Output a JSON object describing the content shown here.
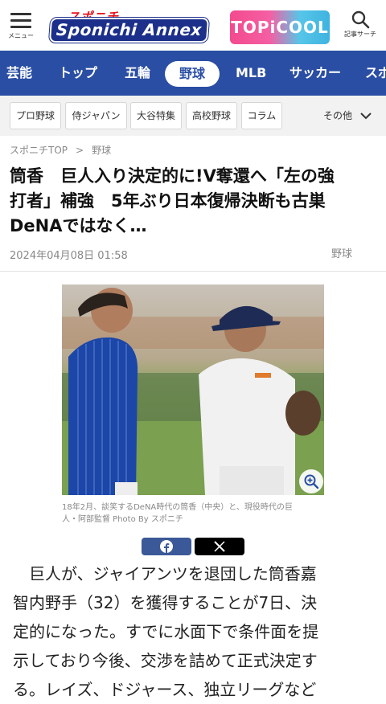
{
  "header": {
    "menu_label": "メニュー",
    "logo_top": "スポニチ",
    "logo_main": "Sponichi Annex",
    "banner_text": "TOPiCOOL",
    "search_label": "記事サーチ"
  },
  "nav": {
    "items": [
      "芸能",
      "トップ",
      "五輪",
      "野球",
      "MLB",
      "サッカー",
      "スポ"
    ],
    "active": "野球"
  },
  "subnav": {
    "items": [
      "プロ野球",
      "侍ジャパン",
      "大谷特集",
      "高校野球",
      "コラム"
    ],
    "more_label": "その他"
  },
  "breadcrumb": {
    "home": "スポニチTOP",
    "separator": ">",
    "current": "野球"
  },
  "article": {
    "title_lines": [
      "筒香　巨人入り決定的に!V奪還へ「左の強",
      "打者」補強　5年ぶり日本復帰決断も古巣",
      "DeNAではなく…"
    ],
    "date": "2024年04月08日 01:58",
    "category": "野球",
    "photo_caption_lines": [
      "18年2月、談笑するDeNA時代の筒香（中央）と、現役時代の巨",
      "人・阿部監督 Photo By スポニチ"
    ],
    "body_lines": [
      "　巨人が、ジャイアンツを退団した筒香嘉",
      "智内野手（32）を獲得することが7日、決",
      "定的になった。すでに水面下で条件面を提",
      "示しており今後、交渉を詰めて正式決定す",
      "る。レイズ、ドジャース、独立リーグなど"
    ]
  },
  "icons": {
    "menu": "hamburger-icon",
    "search": "search-icon",
    "more": "chevron-down-icon",
    "zoom": "zoom-in-icon",
    "facebook": "facebook-icon",
    "x": "x-icon"
  },
  "colors": {
    "nav_bg": "#2a4ea3",
    "brand_red": "#e8141e",
    "facebook": "#3b5998"
  }
}
